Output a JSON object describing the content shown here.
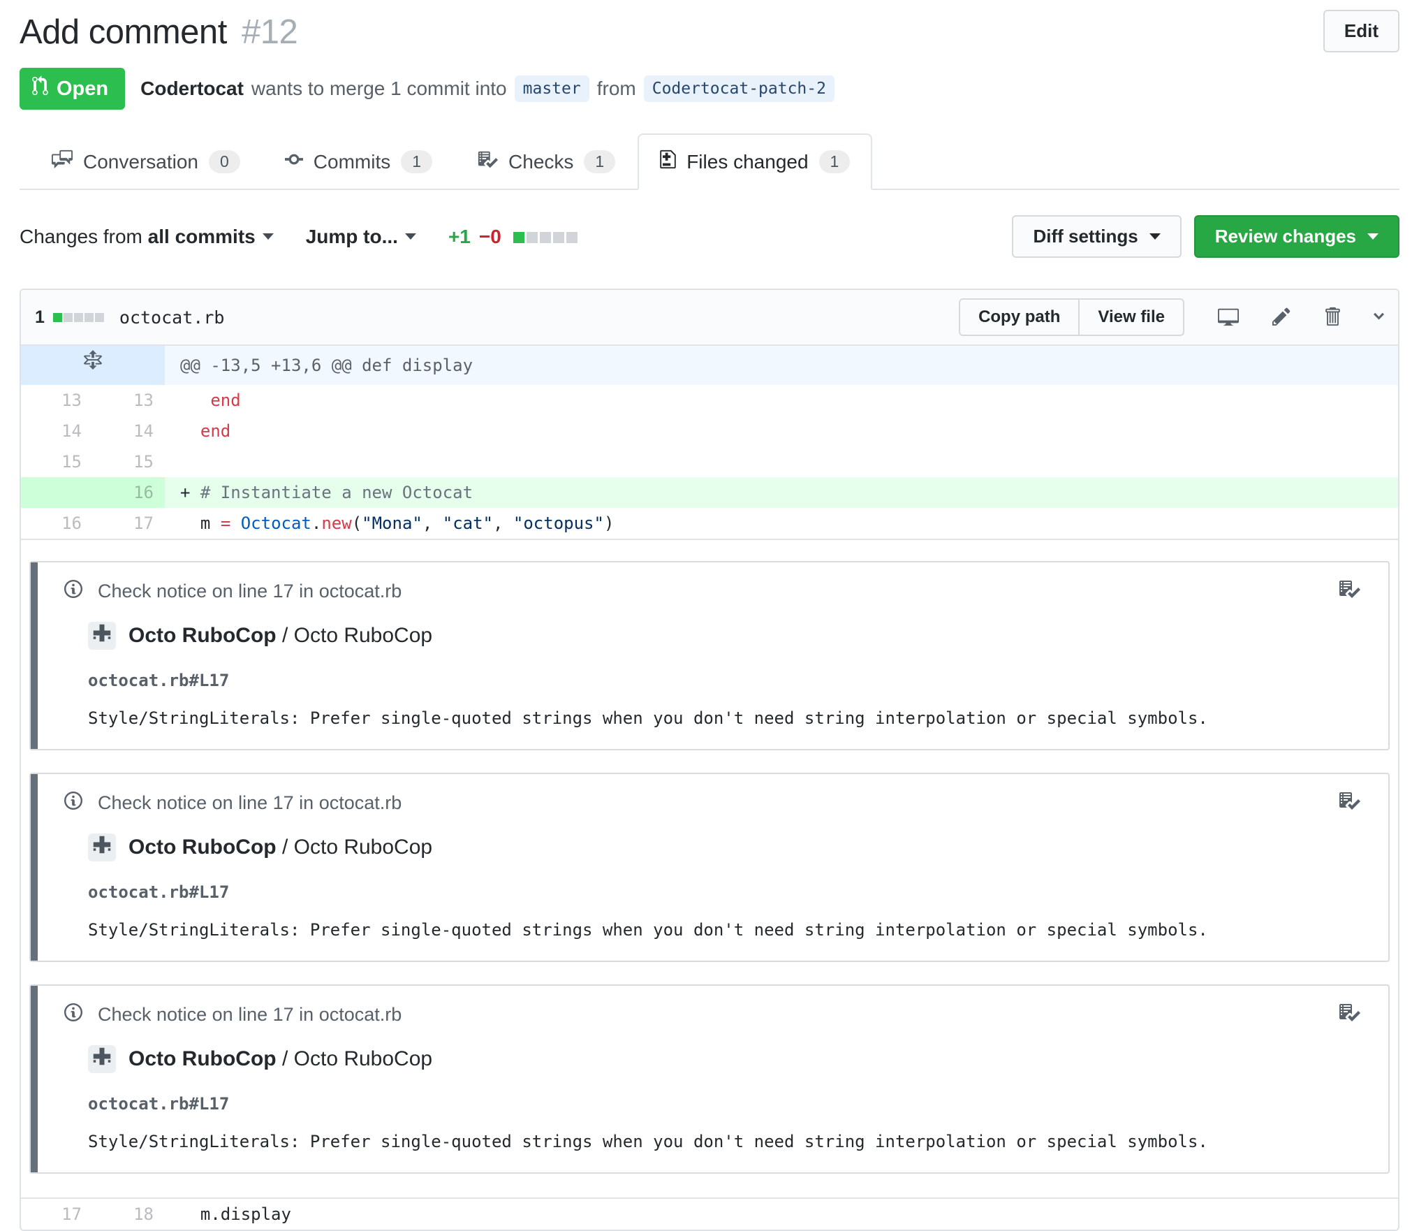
{
  "header": {
    "title": "Add comment",
    "number": "#12",
    "edit_label": "Edit"
  },
  "status": {
    "state": "Open",
    "author": "Codertocat",
    "action": "wants to merge 1 commit into",
    "base_branch": "master",
    "from_word": "from",
    "head_branch": "Codertocat-patch-2"
  },
  "tabs": [
    {
      "label": "Conversation",
      "count": "0",
      "icon": "comment-discussion",
      "active": false
    },
    {
      "label": "Commits",
      "count": "1",
      "icon": "git-commit",
      "active": false
    },
    {
      "label": "Checks",
      "count": "1",
      "icon": "checklist",
      "active": false
    },
    {
      "label": "Files changed",
      "count": "1",
      "icon": "file-diff",
      "active": true
    }
  ],
  "toolbar": {
    "changes_prefix": "Changes from",
    "changes_value": "all commits",
    "jump_to": "Jump to...",
    "additions": "+1",
    "deletions": "−0",
    "diffstat_blocks": [
      "added",
      "empty",
      "empty",
      "empty",
      "empty"
    ],
    "diff_settings_label": "Diff settings",
    "review_changes_label": "Review changes"
  },
  "file": {
    "stat_count": "1",
    "diffstat_blocks": [
      "added",
      "empty",
      "empty",
      "empty",
      "empty"
    ],
    "name": "octocat.rb",
    "copy_path_label": "Copy path",
    "view_file_label": "View file",
    "hunk_header": "@@ -13,5 +13,6 @@ def display"
  },
  "diff": {
    "rows": [
      {
        "old": "13",
        "new": "13",
        "type": "context",
        "tokens": [
          {
            "t": "   ",
            "c": "p"
          },
          {
            "t": "end",
            "c": "k"
          }
        ]
      },
      {
        "old": "14",
        "new": "14",
        "type": "context",
        "tokens": [
          {
            "t": "  ",
            "c": "p"
          },
          {
            "t": "end",
            "c": "k"
          }
        ]
      },
      {
        "old": "15",
        "new": "15",
        "type": "context",
        "tokens": []
      },
      {
        "old": "",
        "new": "16",
        "type": "add",
        "tokens": [
          {
            "t": "+ ",
            "c": "p"
          },
          {
            "t": "# Instantiate a new Octocat",
            "c": "cm"
          }
        ]
      },
      {
        "old": "16",
        "new": "17",
        "type": "context",
        "tokens": [
          {
            "t": "  ",
            "c": "p"
          },
          {
            "t": "m ",
            "c": "p"
          },
          {
            "t": "=",
            "c": "k"
          },
          {
            "t": " ",
            "c": "p"
          },
          {
            "t": "Octocat",
            "c": "o"
          },
          {
            "t": ".",
            "c": "p"
          },
          {
            "t": "new",
            "c": "k"
          },
          {
            "t": "(",
            "c": "p"
          },
          {
            "t": "\"Mona\"",
            "c": "s"
          },
          {
            "t": ", ",
            "c": "p"
          },
          {
            "t": "\"cat\"",
            "c": "s"
          },
          {
            "t": ", ",
            "c": "p"
          },
          {
            "t": "\"octopus\"",
            "c": "s"
          },
          {
            "t": ")",
            "c": "p"
          }
        ]
      }
    ],
    "footer_rows": [
      {
        "old": "17",
        "new": "18",
        "type": "context",
        "tokens": [
          {
            "t": "  ",
            "c": "p"
          },
          {
            "t": "m.display",
            "c": "p"
          }
        ]
      }
    ]
  },
  "annotations": {
    "items": [
      {
        "title": "Check notice on line 17 in octocat.rb",
        "app_name": "Octo RuboCop",
        "separator": " / ",
        "context": "Octo RuboCop",
        "location": "octocat.rb#L17",
        "message": "Style/StringLiterals: Prefer single-quoted strings when you don't need string interpolation or special symbols."
      },
      {
        "title": "Check notice on line 17 in octocat.rb",
        "app_name": "Octo RuboCop",
        "separator": " / ",
        "context": "Octo RuboCop",
        "location": "octocat.rb#L17",
        "message": "Style/StringLiterals: Prefer single-quoted strings when you don't need string interpolation or special symbols."
      },
      {
        "title": "Check notice on line 17 in octocat.rb",
        "app_name": "Octo RuboCop",
        "separator": " / ",
        "context": "Octo RuboCop",
        "location": "octocat.rb#L17",
        "message": "Style/StringLiterals: Prefer single-quoted strings when you don't need string interpolation or special symbols."
      }
    ]
  },
  "colors": {
    "open_badge": "#2cbe4e",
    "review_button": "#28a745",
    "additions": "#28a745",
    "deletions": "#cb2431",
    "added_line_bg": "#e6ffed",
    "added_gutter_bg": "#cdffd8",
    "hunk_bg": "#f1f8ff",
    "hunk_gutter_bg": "#dbedff",
    "keyword": "#d73a49",
    "constant": "#005cc5",
    "string": "#032f62",
    "comment": "#6a737d",
    "branch_label_bg": "#e9f2fb",
    "branch_label_fg": "#26476d"
  }
}
